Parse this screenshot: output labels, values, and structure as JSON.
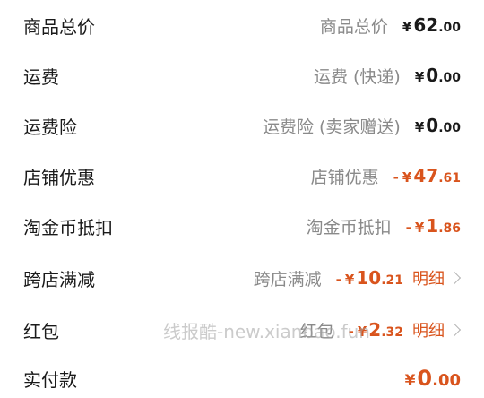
{
  "rows": [
    {
      "label": "商品总价",
      "sublabel": "商品总价",
      "sign": "",
      "yen": "¥",
      "int": "62",
      "dec": ".00",
      "discount": false
    },
    {
      "label": "运费",
      "sublabel": "运费 (快递)",
      "sign": "",
      "yen": "¥",
      "int": "0",
      "dec": ".00",
      "discount": false
    },
    {
      "label": "运费险",
      "sublabel": "运费险 (卖家赠送)",
      "sign": "",
      "yen": "¥",
      "int": "0",
      "dec": ".00",
      "discount": false
    },
    {
      "label": "店铺优惠",
      "sublabel": "店铺优惠",
      "sign": "-",
      "yen": "¥",
      "int": "47",
      "dec": ".61",
      "discount": true
    },
    {
      "label": "淘金币抵扣",
      "sublabel": "淘金币抵扣",
      "sign": "-",
      "yen": "¥",
      "int": "1",
      "dec": ".86",
      "discount": true
    },
    {
      "label": "跨店满减",
      "sublabel": "跨店满减",
      "sign": "-",
      "yen": "¥",
      "int": "10",
      "dec": ".21",
      "discount": true,
      "detail": "明细"
    },
    {
      "label": "红包",
      "sublabel": "红包",
      "sign": "-",
      "yen": "¥",
      "int": "2",
      "dec": ".32",
      "discount": true,
      "detail": "明细"
    }
  ],
  "total": {
    "label": "实付款",
    "yen": "¥",
    "int": "0",
    "dec": ".00"
  },
  "watermark": "线报酷-new.xianbao.fun",
  "colors": {
    "discount": "#d9541d",
    "text": "#1a1a1a",
    "muted": "#8a8a8a"
  }
}
